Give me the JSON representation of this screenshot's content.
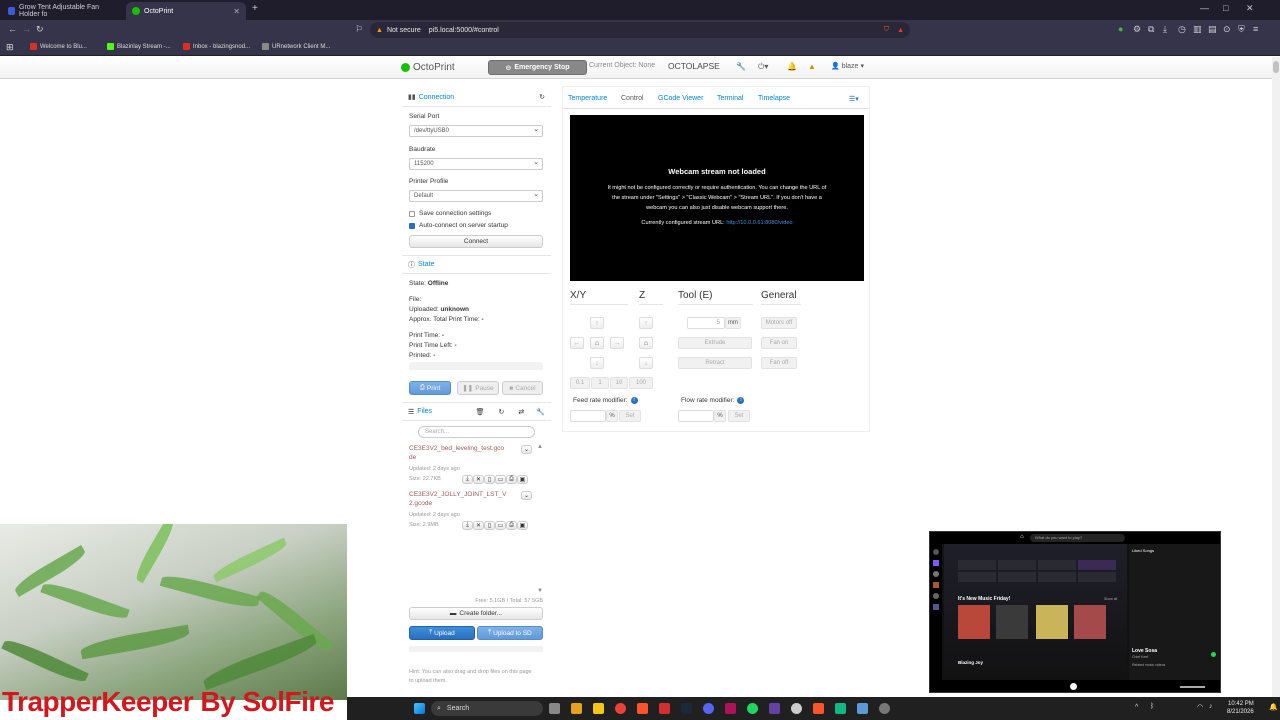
{
  "browser": {
    "tabs": [
      {
        "title": "Grow Tent Adjustable Fan Holder fo",
        "active": false
      },
      {
        "title": "OctoPrint",
        "active": true
      }
    ],
    "new_tab": "+",
    "security": "Not secure",
    "url": "pi5.local:5000/#control",
    "bookmarks": [
      "Welcome to Blu...",
      "Blazinlay Stream -...",
      "Inbox - blazingsnod...",
      "URnetwork Client M..."
    ]
  },
  "navbar": {
    "brand": "OctoPrint",
    "emergency_stop": "Emergency Stop",
    "current_object": "Current Object: None",
    "octolapse": "OCTOLAPSE",
    "user": "blaze"
  },
  "connection": {
    "heading": "Connection",
    "serial_port_label": "Serial Port",
    "serial_port_value": "/dev/ttyUSB0",
    "baudrate_label": "Baudrate",
    "baudrate_value": "115200",
    "profile_label": "Printer Profile",
    "profile_value": "Default",
    "save_settings": "Save connection settings",
    "auto_connect": "Auto-connect on server startup",
    "connect_button": "Connect"
  },
  "state": {
    "heading": "State",
    "state_label": "State:",
    "state_value": "Offline",
    "file_label": "File:",
    "uploaded_label": "Uploaded:",
    "uploaded_value": "unknown",
    "approx_label": "Approx. Total Print Time:",
    "approx_value": "-",
    "print_time_label": "Print Time:",
    "print_time_value": "-",
    "time_left_label": "Print Time Left:",
    "time_left_value": "-",
    "printed_label": "Printed:",
    "printed_value": "-",
    "print_button": "Print",
    "pause_button": "Pause",
    "cancel_button": "Cancel"
  },
  "files": {
    "heading": "Files",
    "search_placeholder": "Search...",
    "items": [
      {
        "name_l1": "CE3E3V2_bed_leveling_test.gco",
        "name_l2": "de",
        "updated": "Updated: 2 days ago",
        "size": "Size: 22.7KB"
      },
      {
        "name_l1": "CE3E3V2_JOLLY_JOINT_LST_V",
        "name_l2": "2.gcode",
        "updated": "Updated: 2 days ago",
        "size": "Size: 2.9MB"
      }
    ],
    "storage": "Free: 5.1GB / Total: 57.5GB",
    "create_folder": "Create folder...",
    "upload": "Upload",
    "upload_sd": "Upload to SD",
    "hint_l1": "Hint: You can also drag and drop files on this page",
    "hint_l2": "to upload them."
  },
  "tabs": [
    "Temperature",
    "Control",
    "GCode Viewer",
    "Terminal",
    "Timelapse"
  ],
  "webcam": {
    "title": "Webcam stream not loaded",
    "line1": "It might not be configured correctly or require authentication. You can change the URL of",
    "line2": "the stream under \"Settings\" > \"Classic Webcam\" > \"Stream URL\". If you don't have a",
    "line3": "webcam you can also just disable webcam support there.",
    "configured_label": "Currently configured stream URL:",
    "configured_url": "http://10.0.0.61:8080/video"
  },
  "control": {
    "xy_heading": "X/Y",
    "z_heading": "Z",
    "tool_heading": "Tool (E)",
    "general_heading": "General",
    "extrude_amount": "5",
    "extrude_unit": "mm",
    "extrude_button": "Extrude",
    "retract_button": "Retract",
    "motors_off": "Motors off",
    "fan_on": "Fan on",
    "fan_off": "Fan off",
    "steps": [
      "0.1",
      "1",
      "10",
      "100"
    ],
    "feed_rate_label": "Feed rate modifier:",
    "flow_rate_label": "Flow rate modifier:",
    "percent": "%",
    "set": "Set"
  },
  "overlay": {
    "watermark": "TrapperKeeper By SolFire"
  },
  "spotify": {
    "search_placeholder": "What do you want to play?",
    "liked_songs": "Liked Songs",
    "new_music": "It's New Music Friday!",
    "show_all": "Show all",
    "section2": "Blazing Joy",
    "now_playing_title": "Love Sosa",
    "now_playing_artist": "Chief Keef",
    "related": "Related music videos"
  },
  "taskbar": {
    "search": "Search",
    "time": "10:42 PM",
    "date": "8/21/2026"
  }
}
